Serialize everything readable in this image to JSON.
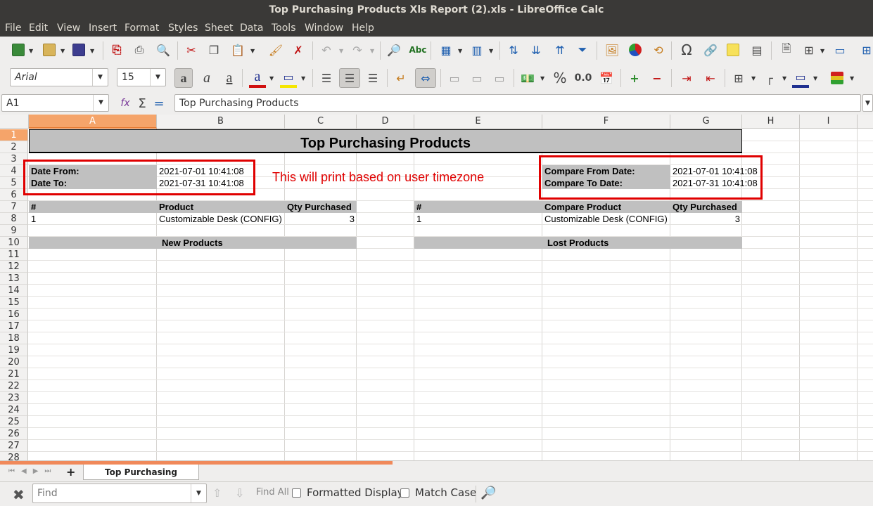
{
  "window": {
    "title": "Top Purchasing Products Xls Report (2).xls - LibreOffice Calc"
  },
  "menu": [
    "File",
    "Edit",
    "View",
    "Insert",
    "Format",
    "Styles",
    "Sheet",
    "Data",
    "Tools",
    "Window",
    "Help"
  ],
  "toolbar2": {
    "font_name": "Arial",
    "font_size": "15",
    "decimals_label": "0.0",
    "percent_label": "%"
  },
  "formula_bar": {
    "cell_ref": "A1",
    "content": "Top Purchasing Products",
    "sum_icon": "Σ",
    "equals_icon": "="
  },
  "columns": [
    "A",
    "B",
    "C",
    "D",
    "E",
    "F",
    "G",
    "H",
    "I"
  ],
  "rows": [
    "1",
    "2",
    "3",
    "4",
    "5",
    "6",
    "7",
    "8",
    "9",
    "10",
    "11",
    "12",
    "13",
    "14",
    "15",
    "16",
    "17",
    "18",
    "19",
    "20",
    "21",
    "22",
    "23",
    "24",
    "25",
    "26",
    "27",
    "28"
  ],
  "sheet": {
    "title": "Top Purchasing Products",
    "date_from_label": "Date From:",
    "date_from_value": "2021-07-01 10:41:08",
    "date_to_label": "Date To:",
    "date_to_value": "2021-07-31 10:41:08",
    "compare_from_label": "Compare From Date:",
    "compare_from_value": "2021-07-01 10:41:08",
    "compare_to_label": "Compare To Date:",
    "compare_to_value": "2021-07-31 10:41:08",
    "left_table": {
      "h_num": "#",
      "h_product": "Product",
      "h_qty": "Qty Purchased",
      "r_num": "1",
      "r_product": "Customizable Desk (CONFIG)",
      "r_qty": "3"
    },
    "right_table": {
      "h_num": "#",
      "h_product": "Compare Product",
      "h_qty": "Qty Purchased",
      "r_num": "1",
      "r_product": "Customizable Desk (CONFIG)",
      "r_qty": "3"
    },
    "new_products": "New Products",
    "lost_products": "Lost Products",
    "annotation": "This will print based on user timezone"
  },
  "sheet_tabs": [
    "Top Purchasing Products"
  ],
  "find_bar": {
    "placeholder": "Find",
    "find_all": "Find All",
    "formatted_display": "Formatted Display",
    "match_case": "Match Case"
  },
  "colors": {
    "accent": "#e77b32",
    "annotation_red": "#e00000",
    "header_gray": "#c0c0c0"
  }
}
